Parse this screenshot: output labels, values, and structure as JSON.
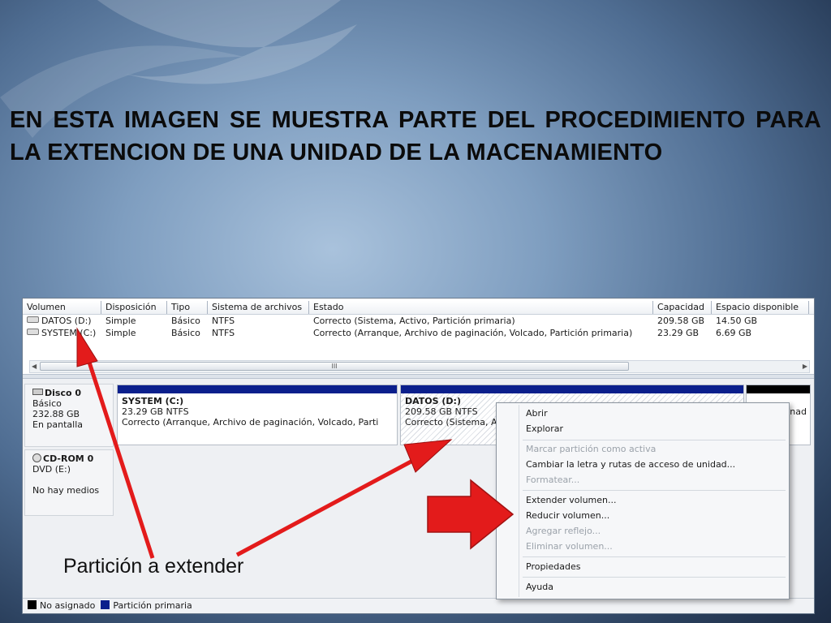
{
  "slide": {
    "title": "EN ESTA IMAGEN SE MUESTRA PARTE DEL PROCEDIMIENTO PARA LA EXTENCION DE UNA UNIDAD DE LA MACENAMIENTO",
    "annotation": "Partición a extender"
  },
  "volume_table": {
    "columns": [
      "Volumen",
      "Disposición",
      "Tipo",
      "Sistema de archivos",
      "Estado",
      "Capacidad",
      "Espacio disponible"
    ],
    "rows": [
      {
        "volumen": "DATOS (D:)",
        "disposicion": "Simple",
        "tipo": "Básico",
        "fs": "NTFS",
        "estado": "Correcto (Sistema, Activo, Partición primaria)",
        "capacidad": "209.58 GB",
        "disponible": "14.50 GB"
      },
      {
        "volumen": "SYSTEM (C:)",
        "disposicion": "Simple",
        "tipo": "Básico",
        "fs": "NTFS",
        "estado": "Correcto (Arranque, Archivo de paginación, Volcado, Partición primaria)",
        "capacidad": "23.29 GB",
        "disponible": "6.69 GB"
      }
    ],
    "scroll_grip": "III"
  },
  "disks": {
    "disk0": {
      "name": "Disco 0",
      "type": "Básico",
      "size": "232.88 GB",
      "status": "En pantalla"
    },
    "cdrom0": {
      "name": "CD-ROM 0",
      "drive": "DVD (E:)",
      "status": "No hay medios"
    }
  },
  "partitions": {
    "system": {
      "name": "SYSTEM (C:)",
      "size": "23.29 GB NTFS",
      "status": "Correcto (Arranque, Archivo de paginación, Volcado, Parti"
    },
    "datos": {
      "name": "DATOS (D:)",
      "size": "209.58 GB NTFS",
      "status": "Correcto (Sistema, A"
    },
    "unallocated_partial": "nad"
  },
  "context_menu": {
    "items": [
      "Abrir",
      "Explorar",
      "Marcar partición como activa",
      "Cambiar la letra y rutas de acceso de unidad...",
      "Formatear...",
      "Extender volumen...",
      "Reducir volumen...",
      "Agregar reflejo...",
      "Eliminar volumen...",
      "Propiedades",
      "Ayuda"
    ]
  },
  "legend": {
    "unallocated": "No asignado",
    "primary": "Partición primaria"
  },
  "colors": {
    "primary_partition": "#0b1f8c",
    "unallocated": "#000000",
    "arrow": "#e31b1b"
  }
}
